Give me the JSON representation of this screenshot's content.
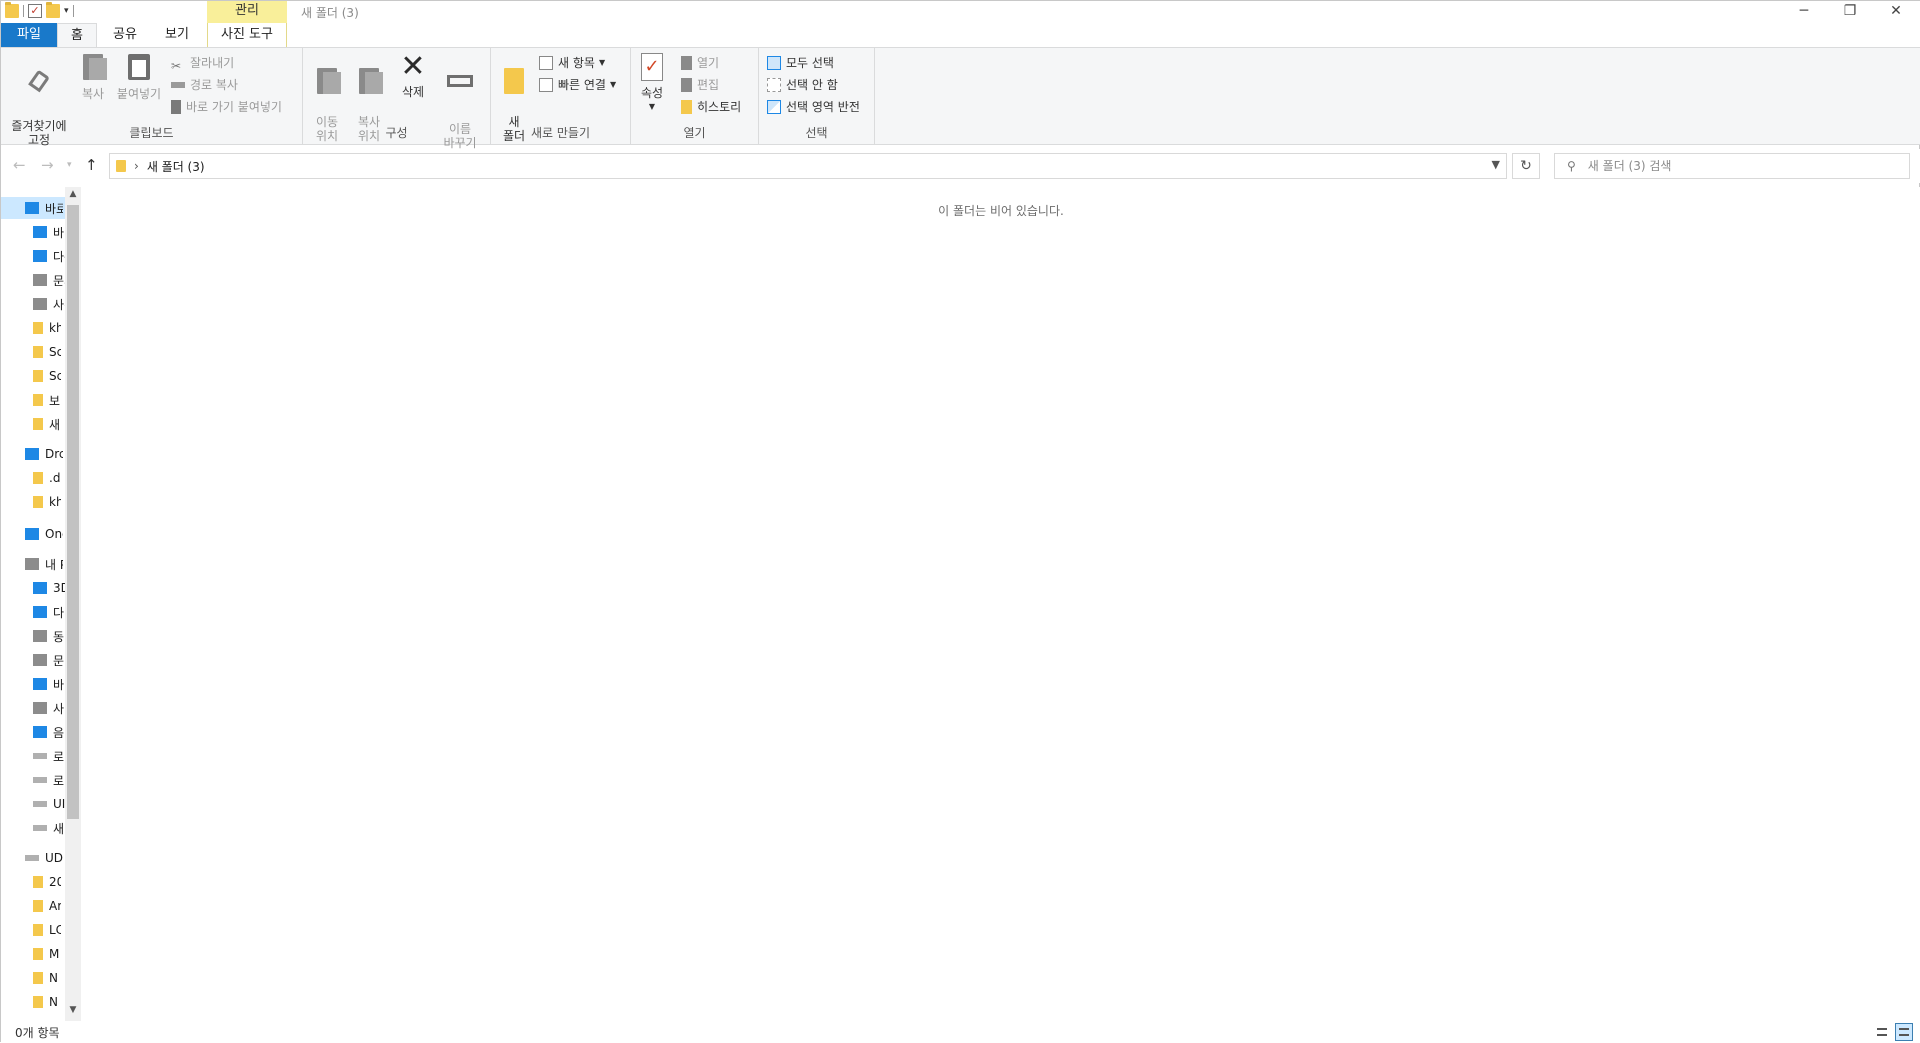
{
  "titlebar": {
    "context_tab": "관리",
    "title": "새 폴더 (3)",
    "minimize_icon": "minimize-icon",
    "restore_icon": "restore-icon",
    "close_icon": "close-icon"
  },
  "tabs": {
    "file": "파일",
    "home": "홈",
    "share": "공유",
    "view": "보기",
    "picture_tools": "사진 도구"
  },
  "ribbon": {
    "clipboard": {
      "label": "클립보드",
      "pin": "즐겨찾기에\n고정",
      "copy": "복사",
      "paste": "붙여넣기",
      "cut": "잘라내기",
      "copy_path": "경로 복사",
      "paste_shortcut": "바로 가기 붙여넣기"
    },
    "organize": {
      "label": "구성",
      "move_to": "이동\n위치",
      "copy_to": "복사\n위치",
      "delete": "삭제",
      "rename": "이름\n바꾸기"
    },
    "new": {
      "label": "새로 만들기",
      "new_folder": "새\n폴더",
      "new_item": "새 항목",
      "easy_access": "빠른 연결"
    },
    "open": {
      "label": "열기",
      "properties": "속성",
      "open": "열기",
      "edit": "편집",
      "history": "히스토리"
    },
    "select": {
      "label": "선택",
      "select_all": "모두 선택",
      "select_none": "선택 안 함",
      "invert": "선택 영역 반전"
    }
  },
  "address": {
    "crumb": "새 폴더 (3)",
    "search_placeholder": "새 폴더 (3) 검색"
  },
  "navpane": {
    "items": [
      {
        "label": "바로 가기",
        "icon": "star-icon"
      },
      {
        "label": "바탕 화면",
        "icon": "desktop-icon"
      },
      {
        "label": "다운로드",
        "icon": "download-icon"
      },
      {
        "label": "문서",
        "icon": "documents-icon"
      },
      {
        "label": "사진",
        "icon": "pictures-icon"
      },
      {
        "label": "kh",
        "icon": "folder-icon"
      },
      {
        "label": "Sc",
        "icon": "folder-icon"
      },
      {
        "label": "Sc",
        "icon": "folder-icon"
      },
      {
        "label": "보",
        "icon": "folder-icon"
      },
      {
        "label": "새",
        "icon": "folder-icon"
      },
      {
        "label": "Drc",
        "icon": "dropbox-icon"
      },
      {
        "label": ".d",
        "icon": "folder-icon"
      },
      {
        "label": "kh",
        "icon": "folder-icon"
      },
      {
        "label": "One",
        "icon": "onedrive-icon"
      },
      {
        "label": "내 PC",
        "icon": "pc-icon"
      },
      {
        "label": "3D",
        "icon": "3d-objects-icon"
      },
      {
        "label": "다",
        "icon": "download-icon"
      },
      {
        "label": "동",
        "icon": "videos-icon"
      },
      {
        "label": "문",
        "icon": "documents-icon"
      },
      {
        "label": "바",
        "icon": "desktop-icon"
      },
      {
        "label": "사",
        "icon": "pictures-icon"
      },
      {
        "label": "음",
        "icon": "music-icon"
      },
      {
        "label": "로",
        "icon": "drive-icon"
      },
      {
        "label": "로",
        "icon": "drive-icon"
      },
      {
        "label": "UI",
        "icon": "drive-icon"
      },
      {
        "label": "새",
        "icon": "drive-icon"
      },
      {
        "label": "UD",
        "icon": "drive-icon"
      },
      {
        "label": "20",
        "icon": "folder-icon"
      },
      {
        "label": "Ar",
        "icon": "folder-icon"
      },
      {
        "label": "LC",
        "icon": "folder-icon"
      },
      {
        "label": "M",
        "icon": "folder-icon"
      },
      {
        "label": "N",
        "icon": "folder-icon"
      },
      {
        "label": "N",
        "icon": "folder-icon"
      }
    ]
  },
  "content": {
    "empty_message": "이 폴더는 비어 있습니다."
  },
  "status": {
    "item_count": "0개 항목"
  }
}
